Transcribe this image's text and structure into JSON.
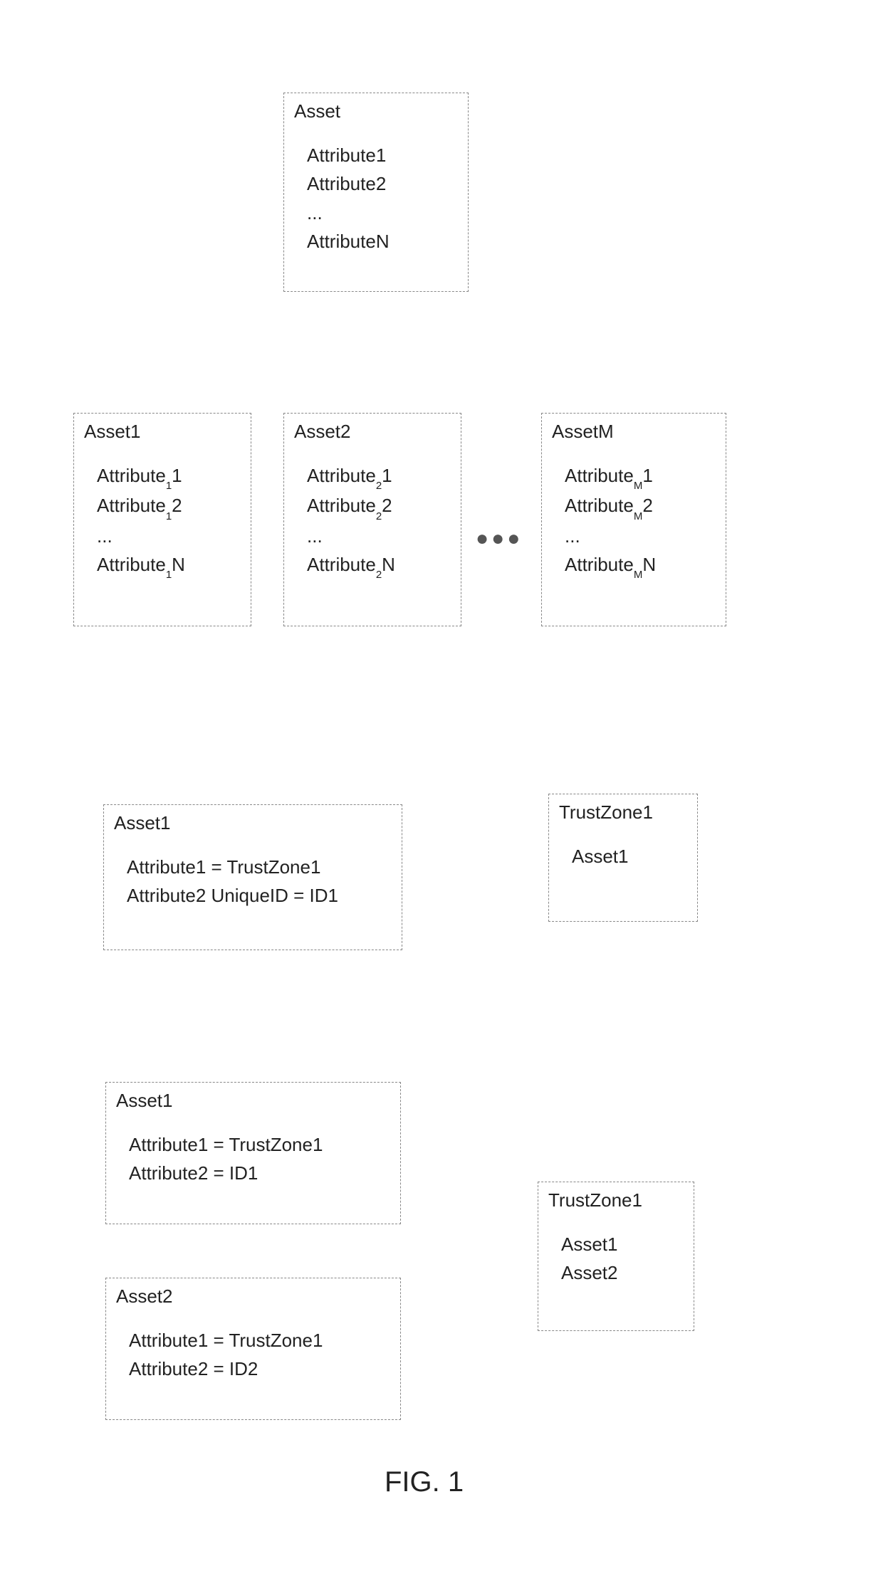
{
  "figure_caption": "FIG. 1",
  "top_box": {
    "title": "Asset",
    "a1": "Attribute1",
    "a2": "Attribute2",
    "ell": "...",
    "aN": "AttributeN"
  },
  "row2": {
    "b1": {
      "title": "Asset1",
      "pre": "Attribute",
      "sub": "1",
      "s1": "1",
      "s2": "2",
      "sN": "N",
      "ell": "..."
    },
    "b2": {
      "title": "Asset2",
      "pre": "Attribute",
      "sub": "2",
      "s1": "1",
      "s2": "2",
      "sN": "N",
      "ell": "..."
    },
    "bM": {
      "title": "AssetM",
      "pre": "Attribute",
      "sub": "M",
      "s1": "1",
      "s2": "2",
      "sN": "N",
      "ell": "..."
    },
    "dots": "●●●"
  },
  "sec3": {
    "asset1": {
      "title": "Asset1",
      "l1": "Attribute1  = TrustZone1",
      "l2": "Attribute2 UniqueID = ID1"
    },
    "tz1": {
      "title": "TrustZone1",
      "l1": "Asset1"
    }
  },
  "sec4": {
    "asset1": {
      "title": "Asset1",
      "l1": "Attribute1 = TrustZone1",
      "l2": "Attribute2 = ID1"
    },
    "asset2": {
      "title": "Asset2",
      "l1": "Attribute1 = TrustZone1",
      "l2": "Attribute2 = ID2"
    },
    "tz1": {
      "title": "TrustZone1",
      "l1": "Asset1",
      "l2": "Asset2"
    }
  }
}
